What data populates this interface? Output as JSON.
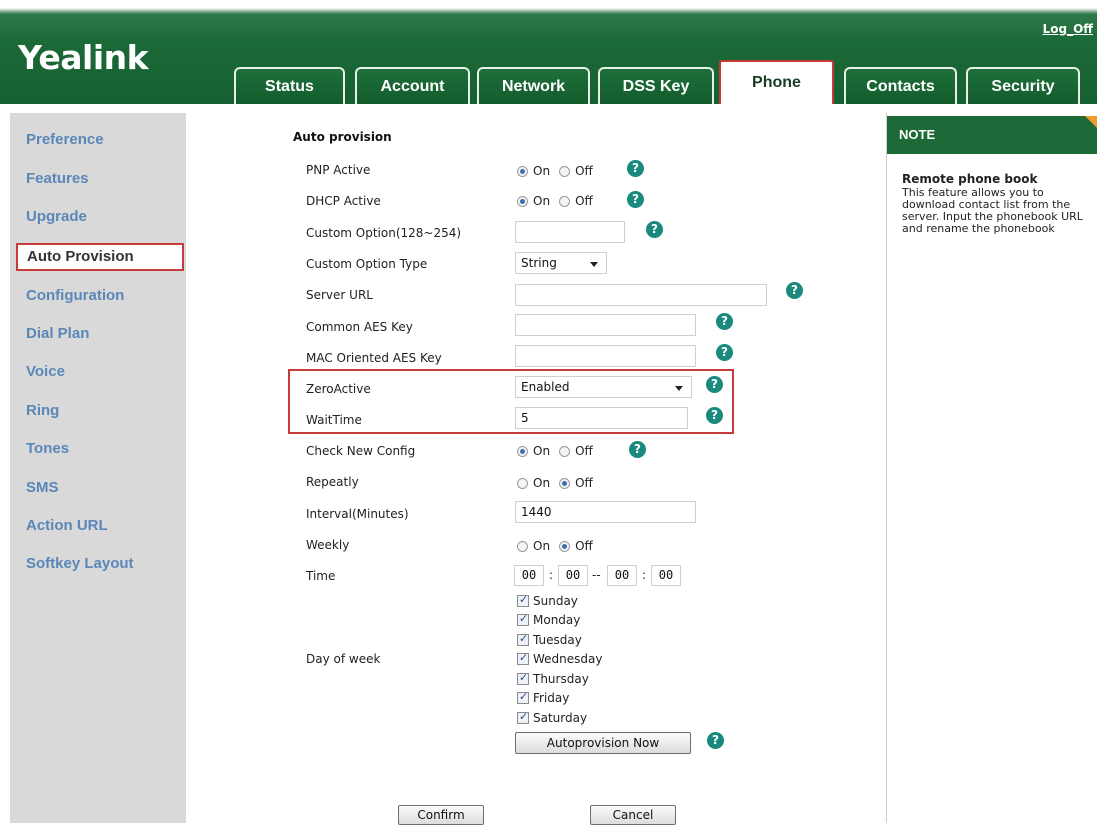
{
  "brand": {
    "logo": "Yealink",
    "logoff": "Log_Off"
  },
  "tabs": [
    {
      "label": "Status"
    },
    {
      "label": "Account"
    },
    {
      "label": "Network"
    },
    {
      "label": "DSS Key"
    },
    {
      "label": "Phone",
      "active": true
    },
    {
      "label": "Contacts"
    },
    {
      "label": "Security"
    }
  ],
  "sidebar": {
    "items": [
      {
        "label": "Preference"
      },
      {
        "label": "Features"
      },
      {
        "label": "Upgrade"
      },
      {
        "label": "Auto Provision",
        "active": true
      },
      {
        "label": "Configuration"
      },
      {
        "label": "Dial Plan"
      },
      {
        "label": "Voice"
      },
      {
        "label": "Ring"
      },
      {
        "label": "Tones"
      },
      {
        "label": "SMS"
      },
      {
        "label": "Action URL"
      },
      {
        "label": "Softkey Layout"
      }
    ]
  },
  "form": {
    "section_title": "Auto provision",
    "radio_on": "On",
    "radio_off": "Off",
    "pnp_active": {
      "label": "PNP Active",
      "value": "On"
    },
    "dhcp_active": {
      "label": "DHCP Active",
      "value": "On"
    },
    "custom_option": {
      "label": "Custom Option(128~254)",
      "value": ""
    },
    "custom_option_type": {
      "label": "Custom Option Type",
      "value": "String"
    },
    "server_url": {
      "label": "Server URL",
      "value": ""
    },
    "common_aes_key": {
      "label": "Common AES Key",
      "value": ""
    },
    "mac_aes_key": {
      "label": "MAC Oriented AES Key",
      "value": ""
    },
    "zero_active": {
      "label": "ZeroActive",
      "value": "Enabled"
    },
    "wait_time": {
      "label": "WaitTime",
      "value": "5"
    },
    "check_new_config": {
      "label": "Check New Config",
      "value": "On"
    },
    "repeatly": {
      "label": "Repeatly",
      "value": "Off"
    },
    "interval": {
      "label": "Interval(Minutes)",
      "value": "1440"
    },
    "weekly": {
      "label": "Weekly",
      "value": "Off"
    },
    "time": {
      "label": "Time",
      "start_h": "00",
      "start_m": "00",
      "end_h": "00",
      "end_m": "00",
      "colon": ":",
      "dash": "--"
    },
    "day_of_week": {
      "label": "Day of week",
      "days": [
        "Sunday",
        "Monday",
        "Tuesday",
        "Wednesday",
        "Thursday",
        "Friday",
        "Saturday"
      ]
    },
    "autoprovision_now": "Autoprovision Now",
    "help_symbol": "?"
  },
  "buttons": {
    "confirm": "Confirm",
    "cancel": "Cancel"
  },
  "note": {
    "header": "NOTE",
    "title": "Remote phone book",
    "body": "This feature allows you to download contact list from the server. Input the phonebook URL and rename the phonebook"
  },
  "colors": {
    "brand_green": "#1d6a38",
    "highlight_red": "#c73a3a",
    "sidebar_link": "#5a87b8",
    "help_teal": "#1a8a7e"
  }
}
